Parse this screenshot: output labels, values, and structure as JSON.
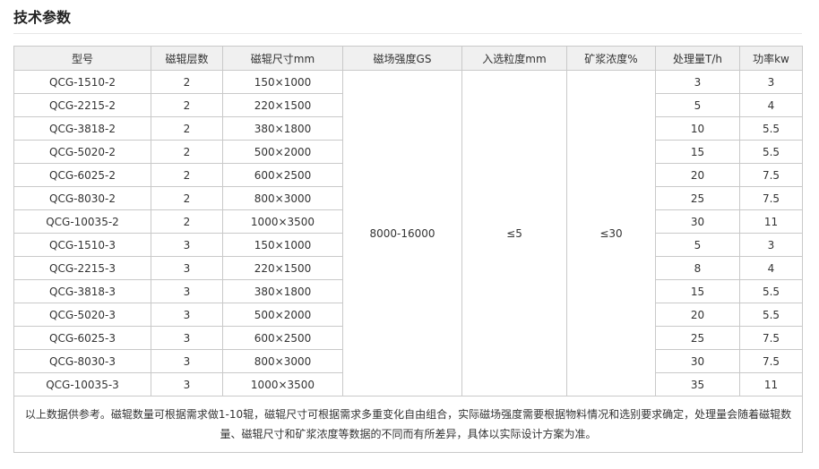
{
  "page_title": "技术参数",
  "headers": [
    "型号",
    "磁辊层数",
    "磁辊尺寸mm",
    "磁场强度GS",
    "入选粒度mm",
    "矿浆浓度%",
    "处理量T/h",
    "功率kw"
  ],
  "shared": {
    "field_strength": "8000-16000",
    "feed_size": "≤5",
    "slurry_concentration": "≤30"
  },
  "rows": [
    [
      "QCG-1510-2",
      "2",
      "150×1000",
      "3",
      "3"
    ],
    [
      "QCG-2215-2",
      "2",
      "220×1500",
      "5",
      "4"
    ],
    [
      "QCG-3818-2",
      "2",
      "380×1800",
      "10",
      "5.5"
    ],
    [
      "QCG-5020-2",
      "2",
      "500×2000",
      "15",
      "5.5"
    ],
    [
      "QCG-6025-2",
      "2",
      "600×2500",
      "20",
      "7.5"
    ],
    [
      "QCG-8030-2",
      "2",
      "800×3000",
      "25",
      "7.5"
    ],
    [
      "QCG-10035-2",
      "2",
      "1000×3500",
      "30",
      "11"
    ],
    [
      "QCG-1510-3",
      "3",
      "150×1000",
      "5",
      "3"
    ],
    [
      "QCG-2215-3",
      "3",
      "220×1500",
      "8",
      "4"
    ],
    [
      "QCG-3818-3",
      "3",
      "380×1800",
      "15",
      "5.5"
    ],
    [
      "QCG-5020-3",
      "3",
      "500×2000",
      "20",
      "5.5"
    ],
    [
      "QCG-6025-3",
      "3",
      "600×2500",
      "25",
      "7.5"
    ],
    [
      "QCG-8030-3",
      "3",
      "800×3000",
      "30",
      "7.5"
    ],
    [
      "QCG-10035-3",
      "3",
      "1000×3500",
      "35",
      "11"
    ]
  ],
  "note": "以上数据供参考。磁辊数量可根据需求做1-10辊，磁辊尺寸可根据需求多重变化自由组合，实际磁场强度需要根据物料情况和选别要求确定，处理量会随着磁辊数量、磁辊尺寸和矿浆浓度等数据的不同而有所差异，具体以实际设计方案为准。"
}
